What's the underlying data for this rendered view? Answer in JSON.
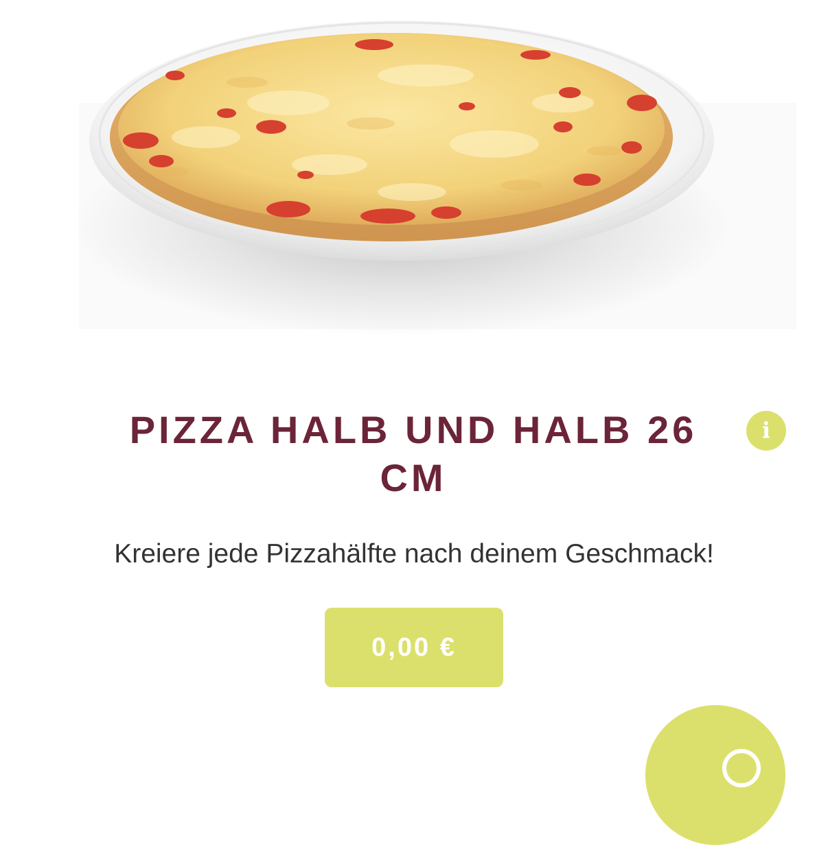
{
  "product": {
    "image_subject": "pizza-on-plate",
    "title": "PIZZA HALB UND HALB 26 CM",
    "description": "Kreiere jede Pizzahälfte nach deinem Geschmack!",
    "price": "0,00 €"
  },
  "info_button": {
    "glyph": "i",
    "icon": "info-icon"
  },
  "fab": {
    "icon": "add-to-cart-icon"
  },
  "colors": {
    "title": "#6b2438",
    "accent": "#dbe06c",
    "text": "#333333",
    "background": "#ffffff"
  }
}
